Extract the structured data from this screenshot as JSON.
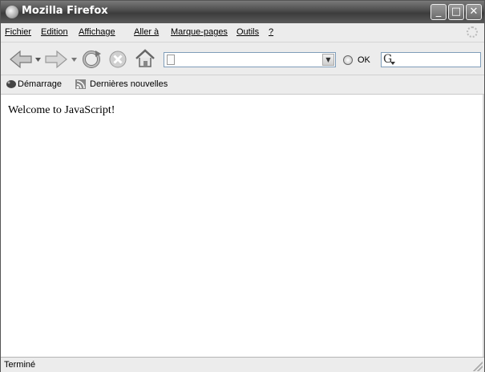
{
  "window": {
    "title": "Mozilla Firefox",
    "controls": {
      "minimize": "_",
      "maximize": "□",
      "close": "✕"
    }
  },
  "menu": {
    "items": [
      {
        "label": "Fichier"
      },
      {
        "label": "Edition"
      },
      {
        "label": "Affichage"
      },
      {
        "label": "Aller à"
      },
      {
        "label": "Marque-pages"
      },
      {
        "label": "Outils"
      },
      {
        "label": "?"
      }
    ]
  },
  "navbar": {
    "url": {
      "value": "",
      "placeholder": ""
    },
    "go_label": "OK",
    "search": {
      "value": "",
      "engine_glyph": "G"
    }
  },
  "bookmarks": {
    "items": [
      {
        "label": "Démarrage",
        "icon": "getting-started-icon"
      },
      {
        "label": "Dernières nouvelles",
        "icon": "rss-feed-icon"
      }
    ]
  },
  "content": {
    "text": "Welcome to JavaScript!"
  },
  "status": {
    "text": "Terminé"
  },
  "colors": {
    "titlebar": "#4a4a4a",
    "toolbar": "#ececec",
    "content_bg": "#ffffff",
    "input_border": "#7f9db9"
  }
}
